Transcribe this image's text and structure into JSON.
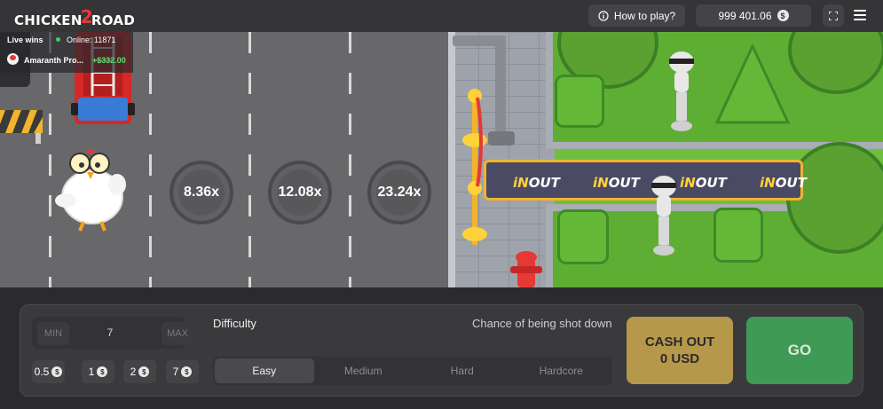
{
  "header": {
    "logo": {
      "left": "CHICKEN",
      "mid": "2",
      "right": "ROAD"
    },
    "how_to_play": "How to play?",
    "balance": "999 401.06",
    "currency_symbol": "$"
  },
  "live_wins": {
    "label": "Live wins",
    "online": "Online: 11871",
    "player": "Amaranth Pro...",
    "amount": "+$332.00"
  },
  "scene": {
    "multipliers": [
      "8.36x",
      "12.08x",
      "23.24x"
    ],
    "banner_text": [
      "iNOUT",
      "iNOUT",
      "iNOUT",
      "iNOUT"
    ],
    "colors": {
      "road": "#68686b",
      "grass": "#5fae34",
      "accent": "#f1b42c"
    }
  },
  "controls": {
    "min_label": "MIN",
    "max_label": "MAX",
    "bet_value": "7",
    "quick_bets": [
      "0.5",
      "1",
      "2",
      "7"
    ],
    "difficulty_label": "Difficulty",
    "chance_label": "Chance of being shot down",
    "difficulties": [
      "Easy",
      "Medium",
      "Hard",
      "Hardcore"
    ],
    "selected_difficulty": "Easy",
    "cashout_line1": "CASH OUT",
    "cashout_line2": "0 USD",
    "go_label": "GO"
  }
}
